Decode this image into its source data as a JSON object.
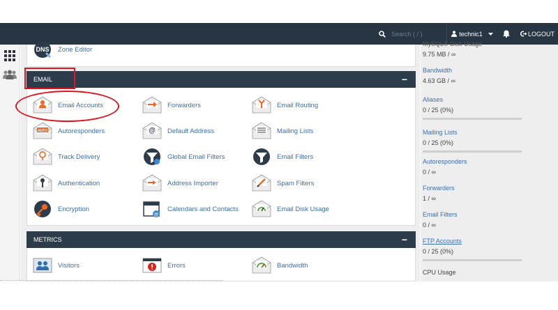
{
  "topbar": {
    "search_placeholder": "Search ( / )",
    "user": "technic1",
    "logout": "LOGOUT"
  },
  "top_item": {
    "label": "Zone Editor",
    "icon": "dns-icon",
    "icon_text": "DNS"
  },
  "email": {
    "header": "EMAIL",
    "items": [
      {
        "label": "Email Accounts",
        "icon": "email-accounts-icon"
      },
      {
        "label": "Forwarders",
        "icon": "forwarders-icon"
      },
      {
        "label": "Email Routing",
        "icon": "email-routing-icon"
      },
      {
        "label": "Autoresponders",
        "icon": "autoresponders-icon",
        "icon_text": "AUTO"
      },
      {
        "label": "Default Address",
        "icon": "default-address-icon"
      },
      {
        "label": "Mailing Lists",
        "icon": "mailing-lists-icon"
      },
      {
        "label": "Track Delivery",
        "icon": "track-delivery-icon"
      },
      {
        "label": "Global Email Filters",
        "icon": "global-email-filters-icon"
      },
      {
        "label": "Email Filters",
        "icon": "email-filters-icon"
      },
      {
        "label": "Authentication",
        "icon": "authentication-icon"
      },
      {
        "label": "Address Importer",
        "icon": "address-importer-icon"
      },
      {
        "label": "Spam Filters",
        "icon": "spam-filters-icon"
      },
      {
        "label": "Encryption",
        "icon": "encryption-icon"
      },
      {
        "label": "Calendars and Contacts",
        "icon": "calendars-contacts-icon"
      },
      {
        "label": "Email Disk Usage",
        "icon": "email-disk-usage-icon"
      }
    ]
  },
  "metrics": {
    "header": "METRICS",
    "items": [
      {
        "label": "Visitors",
        "icon": "visitors-icon"
      },
      {
        "label": "Errors",
        "icon": "errors-icon"
      },
      {
        "label": "Bandwidth",
        "icon": "bandwidth-icon"
      }
    ]
  },
  "stats": {
    "partial_title": "MySQL® Disk Usage",
    "partial_value": "9.75 MB / ∞",
    "cards": [
      {
        "title": "Bandwidth",
        "value": "4.63 GB / ∞"
      },
      {
        "title": "Aliases",
        "value": "0 / 25   (0%)",
        "bar": 0
      },
      {
        "title": "Mailing Lists",
        "value": "0 / 25   (0%)",
        "bar": 0
      },
      {
        "title": "Autoresponders",
        "value": "0 / ∞"
      },
      {
        "title": "Forwarders",
        "value": "1 / ∞"
      },
      {
        "title": "Email Filters",
        "value": "0 / ∞"
      },
      {
        "title": "FTP Accounts",
        "value": "0 / 25   (0%)",
        "bar": 0
      },
      {
        "title": "CPU Usage",
        "value": ""
      }
    ]
  },
  "colors": {
    "accent": "#e0141e",
    "header": "#2d3c4b",
    "topbar": "#283542",
    "link": "#3a6fb0",
    "orange": "#f26522"
  }
}
